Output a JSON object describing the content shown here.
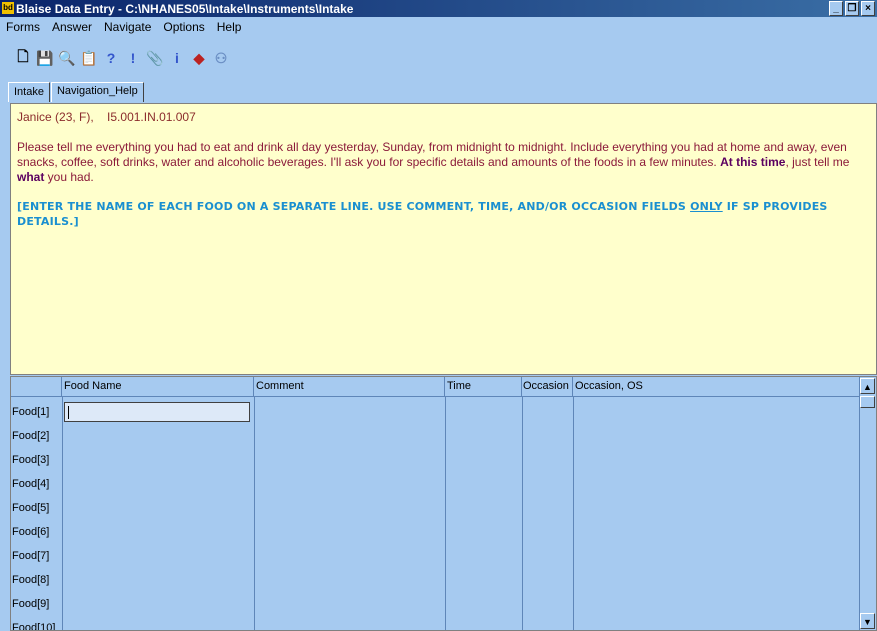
{
  "window": {
    "icon_text": "bd",
    "title": "Blaise Data Entry - C:\\NHANES05\\Intake\\Instruments\\Intake",
    "minimize": "_",
    "restore": "❐",
    "close": "×"
  },
  "menu": {
    "items": [
      "Forms",
      "Answer",
      "Navigate",
      "Options",
      "Help"
    ]
  },
  "toolbar": {
    "icons": [
      "new-document-icon",
      "save-icon",
      "find-icon",
      "copy-icon",
      "help-icon",
      "warning-icon",
      "paperclip-icon",
      "info-icon",
      "remark-icon",
      "users-icon"
    ],
    "glyphs": [
      "🗋",
      "💾",
      "🔍",
      "📋",
      "?",
      "!",
      "📎",
      "i",
      "◆",
      "⚇"
    ]
  },
  "tabs": [
    "Intake",
    "Navigation_Help"
  ],
  "question": {
    "respondent": "Janice (23, F),",
    "id": "I5.001.IN.01.007",
    "text_part1": "Please tell me everything you had to eat and drink all day yesterday, Sunday, from midnight to midnight.  Include everything you had at home and away, even snacks, coffee, soft drinks, water and alcoholic beverages.  I'll ask you for specific details and amounts of the foods in a few minutes.  ",
    "emph1": "At this time",
    "text_part2": ", just tell me ",
    "emph2": "what",
    "text_part3": " you had.",
    "instruction_part1": "[ENTER THE NAME OF EACH FOOD ON A SEPARATE LINE.  USE COMMENT, TIME, AND/OR OCCASION FIELDS ",
    "instruction_emph": "ONLY",
    "instruction_part2": " IF SP PROVIDES DETAILS.]"
  },
  "grid": {
    "columns": [
      "",
      "Food Name",
      "Comment",
      "Time",
      "Occasion",
      "Occasion, OS"
    ],
    "rows": [
      "Food[1]",
      "Food[2]",
      "Food[3]",
      "Food[4]",
      "Food[5]",
      "Food[6]",
      "Food[7]",
      "Food[8]",
      "Food[9]",
      "Food[10]"
    ],
    "scroll_up": "▲",
    "scroll_down": "▼"
  }
}
